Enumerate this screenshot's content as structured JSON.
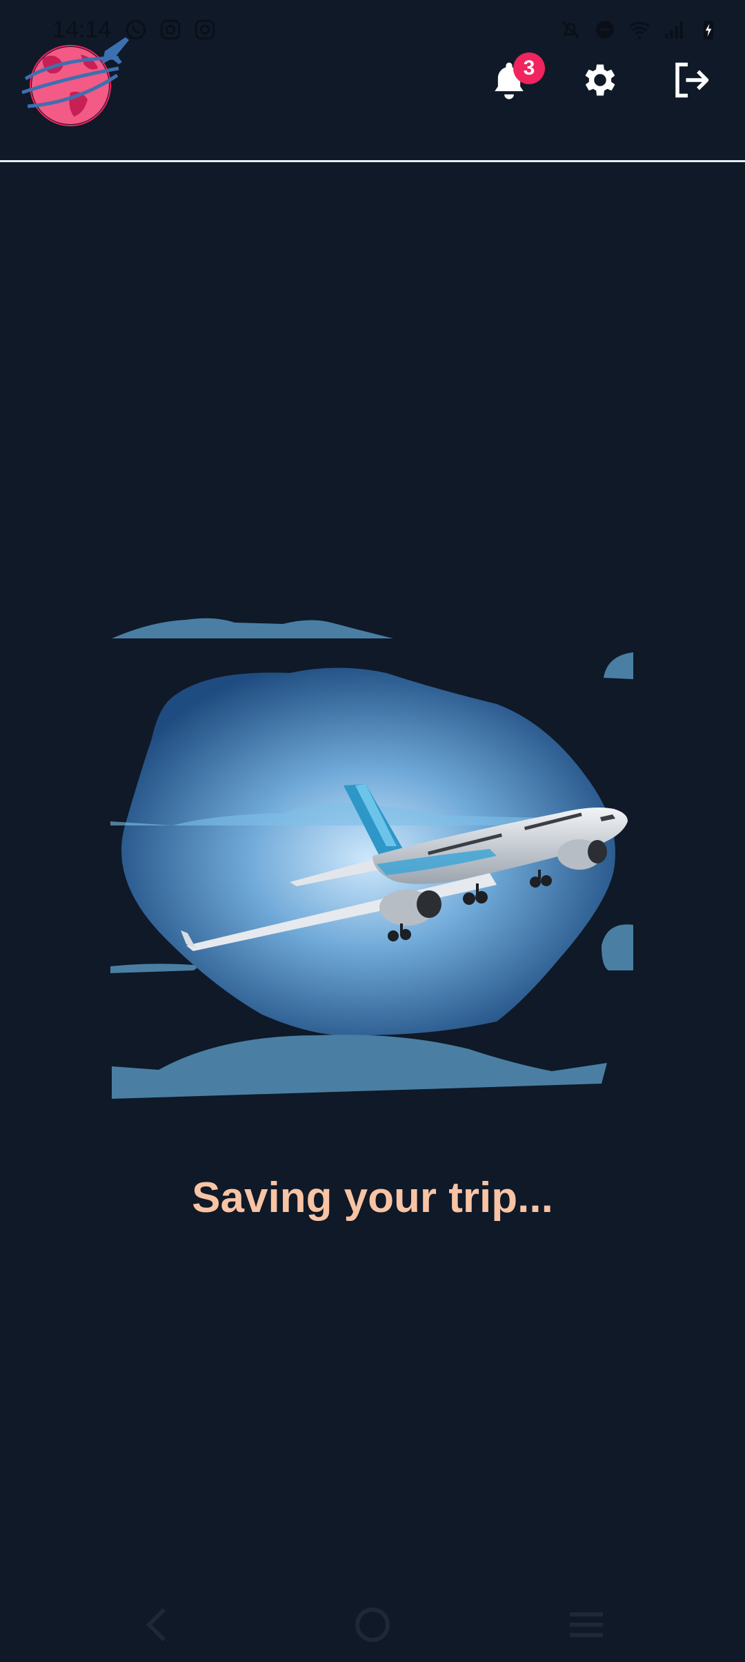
{
  "status_bar": {
    "time": "14:14",
    "left_icons": [
      "whatsapp-icon",
      "instagram-icon",
      "instagram-icon"
    ],
    "right_icons": [
      "notifications-off-icon",
      "do-not-disturb-icon",
      "wifi-icon",
      "signal-icon",
      "battery-charging-icon"
    ]
  },
  "header": {
    "logo_icon": "globe-airplane-logo",
    "notifications": {
      "icon": "bell-icon",
      "badge_count": "3"
    },
    "settings_icon": "gear-icon",
    "logout_icon": "logout-icon"
  },
  "main": {
    "illustration_icon": "airplane-in-clouds-illustration",
    "loading_text": "Saving your trip..."
  },
  "nav_bar": {
    "icons": [
      "back-icon",
      "home-icon",
      "recents-icon"
    ]
  },
  "colors": {
    "background": "#0f1928",
    "accent_pink": "#f0245e",
    "loading_text": "#f8c4a4",
    "cloud": "#4a7fa3",
    "divider": "#e8edf3"
  }
}
